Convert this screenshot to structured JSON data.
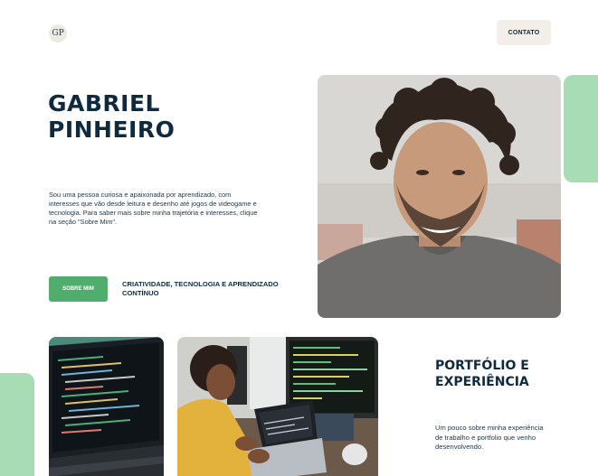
{
  "header": {
    "logo_text": "GP",
    "contact_label": "CONTATO"
  },
  "hero": {
    "name_line1": "GABRIEL",
    "name_line2": "PINHEIRO",
    "intro": "Sou uma pessoa curiosa e apaixonada por aprendizado, com interesses que vão desde leitura e desenho até jogos de videogame e tecnologia. Para saber mais sobre minha trajetória e interesses, clique na seção \"Sobre Mim\".",
    "about_button_label": "SOBRE MIM",
    "tagline": "CRIATIVIDADE, TECNOLOGIA E APRENDIZADO CONTÍNUO"
  },
  "portfolio": {
    "title_line1": "PORTFÓLIO E",
    "title_line2": "EXPERIÊNCIA",
    "description": "Um pouco sobre minha experiência de trabalho e portfolio que venho desenvolvendo."
  },
  "colors": {
    "navy": "#0f2a3d",
    "accent_green": "#4fae6d",
    "light_green": "#a8dcb5",
    "button_bg": "#f2efe9"
  }
}
